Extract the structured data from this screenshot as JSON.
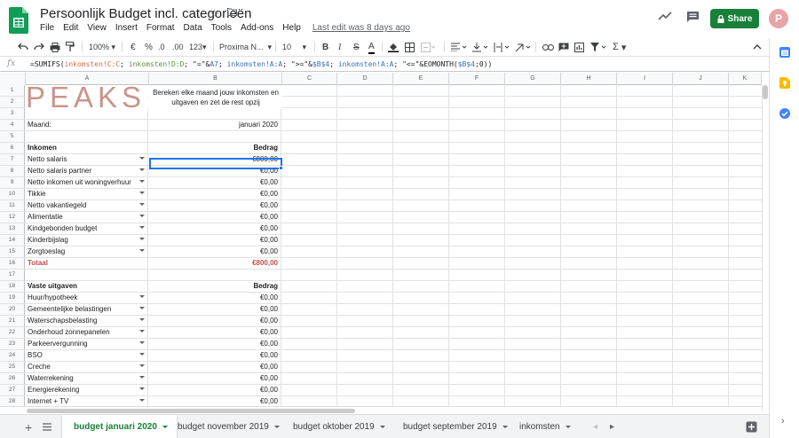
{
  "app": {
    "title": "Persoonlijk Budget incl. categorieën",
    "last_edit": "Last edit was 8 days ago",
    "share_label": "Share",
    "avatar_letter": "P"
  },
  "menu": [
    "File",
    "Edit",
    "View",
    "Insert",
    "Format",
    "Data",
    "Tools",
    "Add-ons",
    "Help"
  ],
  "toolbar": {
    "zoom": "100%",
    "currency": "€",
    "percent": "%",
    "dec_less": ".0",
    "dec_more": ".00",
    "more_formats": "123",
    "font": "Proxima N...",
    "font_size": "10",
    "bold": "B",
    "italic": "I",
    "strike": "S",
    "text_color": "A",
    "sum": "Σ"
  },
  "formula_bar": {
    "fx": "fx",
    "parts": [
      {
        "t": "=SUMIFS(",
        "c": ""
      },
      {
        "t": "inkomsten!C:C",
        "c": "fr"
      },
      {
        "t": "; ",
        "c": ""
      },
      {
        "t": "inkomsten!D:D",
        "c": "fg"
      },
      {
        "t": "; \"=\"&",
        "c": ""
      },
      {
        "t": "A7",
        "c": "fb"
      },
      {
        "t": "; ",
        "c": ""
      },
      {
        "t": "inkomsten!A:A",
        "c": "fb"
      },
      {
        "t": "; \">=\"&",
        "c": ""
      },
      {
        "t": "$B$4",
        "c": "fb"
      },
      {
        "t": "; ",
        "c": ""
      },
      {
        "t": "inkomsten!A:A",
        "c": "fb"
      },
      {
        "t": "; \"<=\"&EOMONTH(",
        "c": ""
      },
      {
        "t": "$B$4",
        "c": "fb"
      },
      {
        "t": ";0))",
        "c": ""
      }
    ]
  },
  "columns": [
    "A",
    "B",
    "C",
    "D",
    "E",
    "F",
    "G",
    "H",
    "I",
    "J",
    "K"
  ],
  "sheet": {
    "logo_text": "PEAKS",
    "tagline": "Bereken elke maand jouw inkomsten en uitgaven en zet de rest opzij",
    "rows": [
      {
        "n": "1",
        "a": "",
        "b": ""
      },
      {
        "n": "2",
        "a": "",
        "b": ""
      },
      {
        "n": "3",
        "a": "",
        "b": ""
      },
      {
        "n": "4",
        "a": "Maand:",
        "b": "januari 2020"
      },
      {
        "n": "5",
        "a": "",
        "b": ""
      },
      {
        "n": "6",
        "a": "Inkomen",
        "b": "Bedrag",
        "style": "bold"
      },
      {
        "n": "7",
        "a": "Netto salaris",
        "b": "€800,00",
        "dd": true
      },
      {
        "n": "8",
        "a": "Netto salaris partner",
        "b": "€0,00",
        "dd": true
      },
      {
        "n": "9",
        "a": "Netto inkomen uit woningverhuur",
        "b": "€0,00",
        "dd": true
      },
      {
        "n": "10",
        "a": "Tikkie",
        "b": "€0,00",
        "dd": true
      },
      {
        "n": "11",
        "a": "Netto vakantiegeld",
        "b": "€0,00",
        "dd": true
      },
      {
        "n": "12",
        "a": "Alimentatie",
        "b": "€0,00",
        "dd": true
      },
      {
        "n": "13",
        "a": "Kindgebonden budget",
        "b": "€0,00",
        "dd": true
      },
      {
        "n": "14",
        "a": "Kinderbijslag",
        "b": "€0,00",
        "dd": true
      },
      {
        "n": "15",
        "a": "Zorgtoeslag",
        "b": "€0,00",
        "dd": true
      },
      {
        "n": "16",
        "a": "Totaal",
        "b": "€800,00",
        "style": "red"
      },
      {
        "n": "17",
        "a": "",
        "b": ""
      },
      {
        "n": "18",
        "a": "Vaste uitgaven",
        "b": "Bedrag",
        "style": "bold"
      },
      {
        "n": "19",
        "a": "Huur/hypotheek",
        "b": "€0,00",
        "dd": true
      },
      {
        "n": "20",
        "a": "Gemeentelijke belastingen",
        "b": "€0,00",
        "dd": true
      },
      {
        "n": "21",
        "a": "Waterschapsbelasting",
        "b": "€0,00",
        "dd": true
      },
      {
        "n": "22",
        "a": "Onderhoud zonnepanelen",
        "b": "€0,00",
        "dd": true
      },
      {
        "n": "23",
        "a": "Parkeervergunning",
        "b": "€0,00",
        "dd": true
      },
      {
        "n": "24",
        "a": "BSO",
        "b": "€0,00",
        "dd": true
      },
      {
        "n": "25",
        "a": "Creche",
        "b": "€0,00",
        "dd": true
      },
      {
        "n": "26",
        "a": "Waterrekening",
        "b": "€0,00",
        "dd": true
      },
      {
        "n": "27",
        "a": "Energierekening",
        "b": "€0,00",
        "dd": true
      },
      {
        "n": "28",
        "a": "Internet + TV",
        "b": "€0,00",
        "dd": true
      }
    ]
  },
  "tabs": [
    {
      "label": "budget januari 2020",
      "active": true
    },
    {
      "label": "budget november 2019"
    },
    {
      "label": "budget oktober 2019"
    },
    {
      "label": "budget september 2019"
    },
    {
      "label": "inkomsten"
    }
  ],
  "colors": {
    "brand_green": "#188038",
    "logo_pink": "#c9948c",
    "total_red": "#c0504d",
    "selection_blue": "#1a73e8"
  },
  "icons": [
    "sheets-logo-icon",
    "star-icon",
    "folder-icon",
    "trend-icon",
    "comment-icon",
    "lock-icon",
    "calendar-icon",
    "keep-icon",
    "tasks-icon"
  ]
}
